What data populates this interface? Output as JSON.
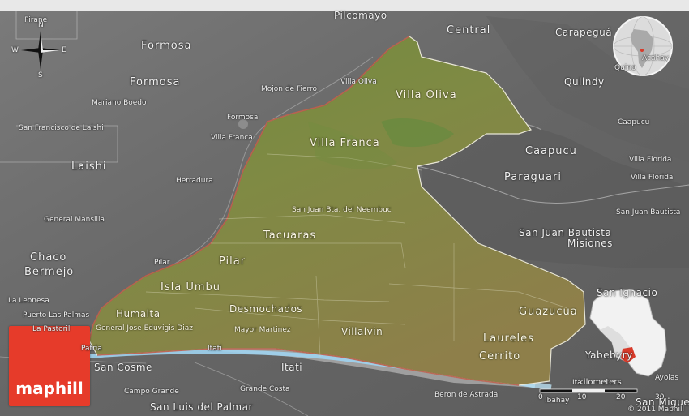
{
  "brand": {
    "logo_text": "maphill",
    "copyright": "© 2011 Maphill"
  },
  "compass": {
    "n": "N",
    "s": "S",
    "e": "E",
    "w": "W"
  },
  "scale": {
    "title": "kilometers",
    "ticks": [
      "0",
      "10",
      "20",
      "30"
    ]
  },
  "colors": {
    "highlight_region": "#7b8a3a",
    "river": "#9fd3ef",
    "logo": "#e63b2a",
    "inset_marker": "#d83a2a"
  },
  "labels": {
    "pirane": "Pirane",
    "pilcomayo": "Pilcomayo",
    "central": "Central",
    "carapegua": "Carapeguá",
    "formosa_dept": "Formosa",
    "formosa_dept2": "Formosa",
    "mojon_de_fierro": "Mojon de Fierro",
    "villa_oliva_town": "Villa Oliva",
    "villa_oliva_dept": "Villa Oliva",
    "quiindy": "Quiindy",
    "quino": "Quino",
    "acahay": "Acahay",
    "mariano_boedo": "Mariano Boedo",
    "formosa_city": "Formosa",
    "san_francisco_de_laishi": "San Francisco de Laishi",
    "villa_franca_town": "Villa Franca",
    "villa_franca_dept": "Villa Franca",
    "caapucu_town": "Caapucu",
    "caapucu_dept": "Caapucu",
    "villa_florida_1": "Villa Florida",
    "villa_florida_2": "Villa Florida",
    "laishi": "Laishi",
    "herradura": "Herradura",
    "paraguari": "Paraguari",
    "san_juan_bta_neembuc": "San Juan Bta. del Neembuc",
    "san_juan_bautista_town": "San Juan Bautista",
    "general_mansilla": "General Mansilla",
    "tacuaras": "Tacuaras",
    "san_juan_bautista_misiones": "San Juan Bautista",
    "misiones": "Misiones",
    "chaco": "Chaco",
    "bermejo": "Bermejo",
    "pilar": "Pilar",
    "pilar_town": "Pilar",
    "isla_umbu": "Isla Umbu",
    "san_ignacio": "San Ignacio",
    "la_leonesa": "La Leonesa",
    "desmochados": "Desmochados",
    "puerto_las_palmas": "Puerto Las Palmas",
    "humaita": "Humaita",
    "guazucua": "Guazucua",
    "general_jose_eduvigis_diaz": "General Jose Eduvigis Diaz",
    "mayor_martinez": "Mayor Martinez",
    "villalvin": "Villalvin",
    "laureles": "Laureles",
    "la_pastoril": "La Pastoril",
    "patria": "Patria",
    "itati_small": "Itati",
    "cerrito": "Cerrito",
    "yabebyry": "Yabebyry",
    "san_cosme": "San Cosme",
    "itati": "Itati",
    "ayolas": "Ayolas",
    "campo_grande": "Campo Grande",
    "grande_costa": "Grande Costa",
    "beron_de_astrada": "Beron de Astrada",
    "ibahay": "Ibahay",
    "san_luis_del_palmar": "San Luis del Palmar",
    "san_miguel": "San Miguel",
    "ita": "Ita"
  }
}
